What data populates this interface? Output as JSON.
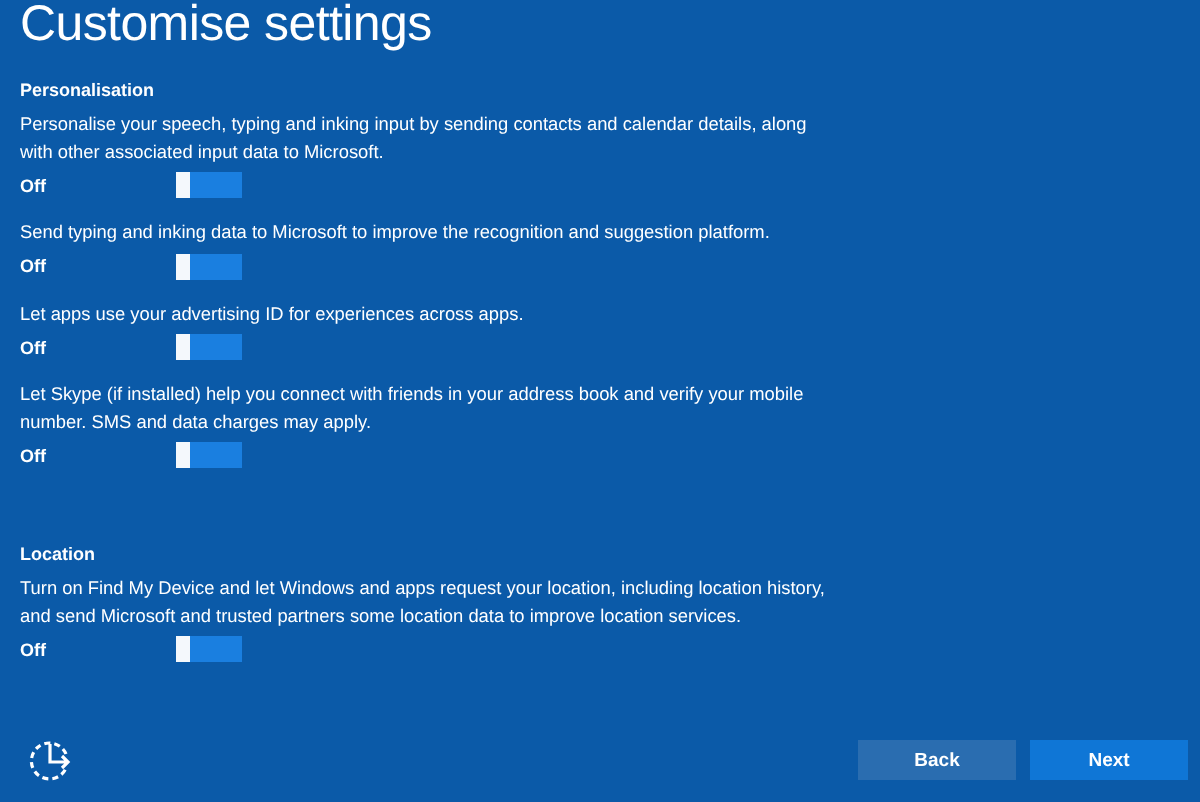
{
  "title": "Customise settings",
  "sections": [
    {
      "heading": "Personalisation",
      "settings": [
        {
          "text": "Personalise your speech, typing and inking input by sending contacts and calendar details, along\nwith other associated input data to Microsoft.",
          "state_label": "Off",
          "on": false
        },
        {
          "text": "Send typing and inking data to Microsoft to improve the recognition and suggestion platform.",
          "state_label": "Off",
          "on": false
        },
        {
          "text": "Let apps use your advertising ID for experiences across apps.",
          "state_label": "Off",
          "on": false
        },
        {
          "text": "Let Skype (if installed) help you connect with friends in your address book and verify your mobile\nnumber. SMS and data charges may apply.",
          "state_label": "Off",
          "on": false
        }
      ]
    },
    {
      "heading": "Location",
      "settings": [
        {
          "text": "Turn on Find My Device and let Windows and apps request your location, including location history,\nand send Microsoft and trusted partners some location data to improve location services.",
          "state_label": "Off",
          "on": false
        }
      ]
    }
  ],
  "buttons": [
    {
      "label": "Back",
      "kind": "secondary"
    },
    {
      "label": "Next",
      "kind": "primary"
    }
  ]
}
